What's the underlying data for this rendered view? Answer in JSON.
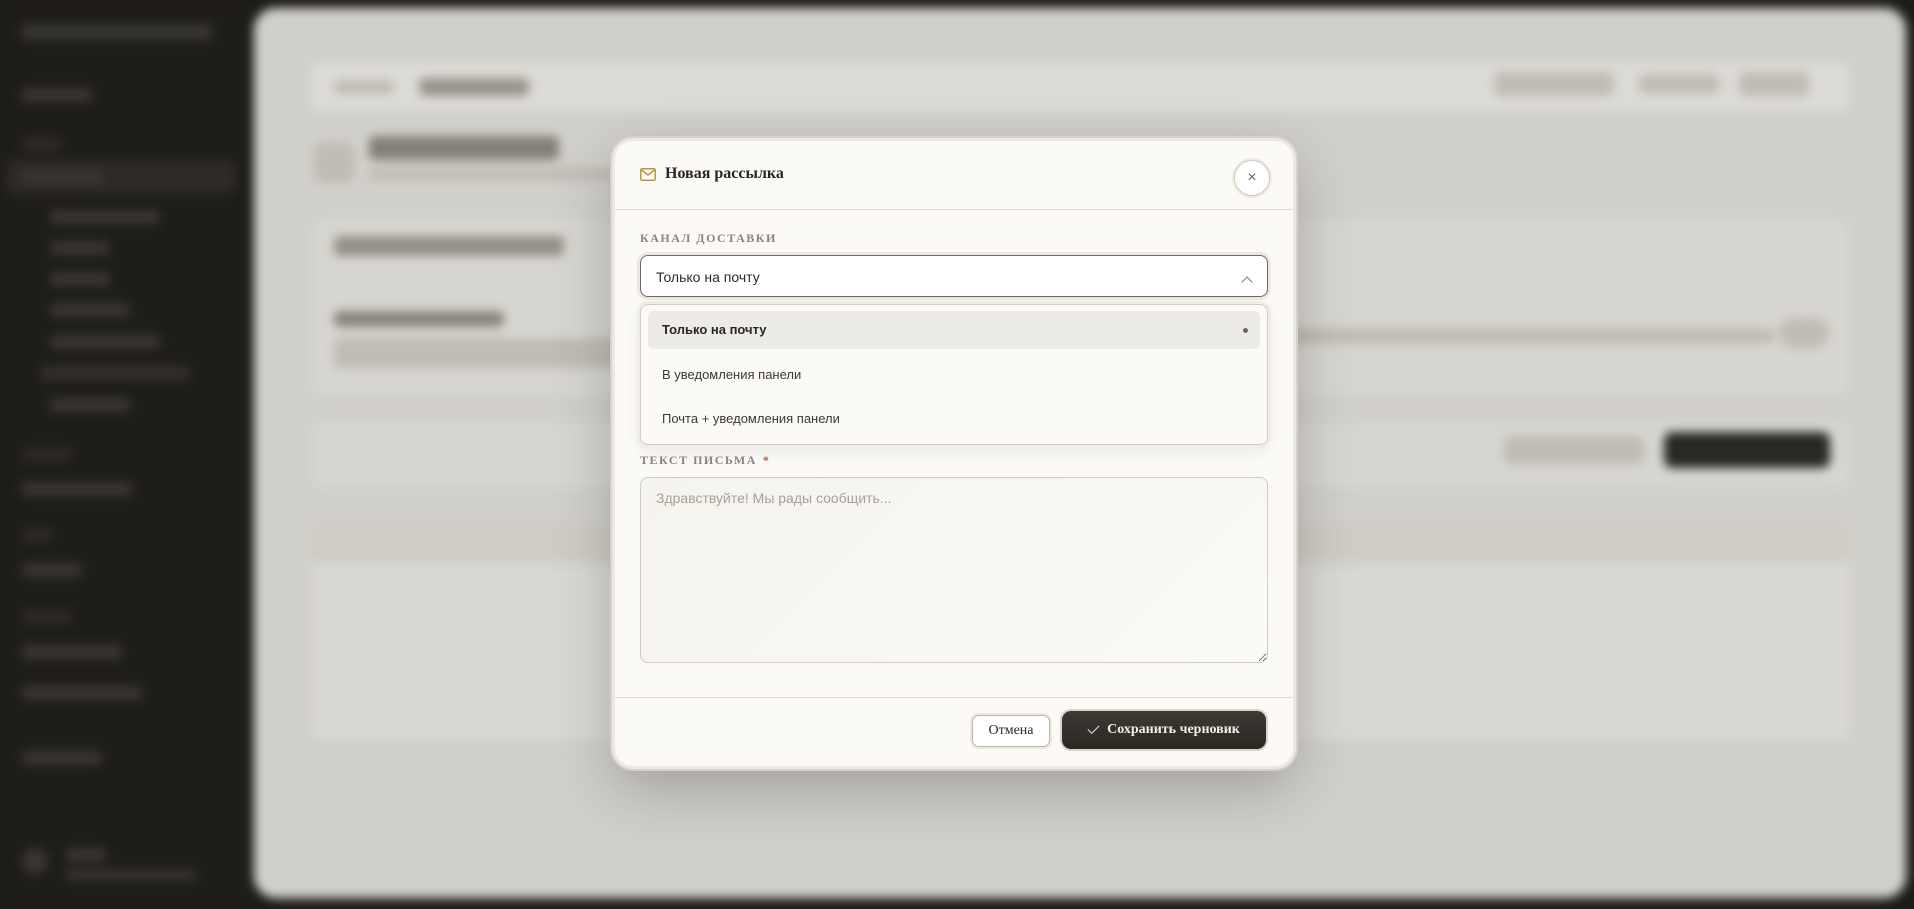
{
  "modal": {
    "title": "Новая рассылка",
    "close_label": "×",
    "channel_label": "КАНАЛ ДОСТАВКИ",
    "channel_selected": "Только на почту",
    "channel_options": [
      {
        "label": "Только на почту",
        "selected": true
      },
      {
        "label": "В уведомления панели",
        "selected": false
      },
      {
        "label": "Почта + уведомления панели",
        "selected": false
      }
    ],
    "body_label": "ТЕКСТ ПИСЬМА",
    "required_mark": "*",
    "body_placeholder": "Здравствуйте! Мы рады сообщить...",
    "cancel_label": "Отмена",
    "save_label": "Сохранить черновик"
  },
  "colors": {
    "accent_icon": "#b8973f",
    "primary_button": "#2f2c27"
  }
}
